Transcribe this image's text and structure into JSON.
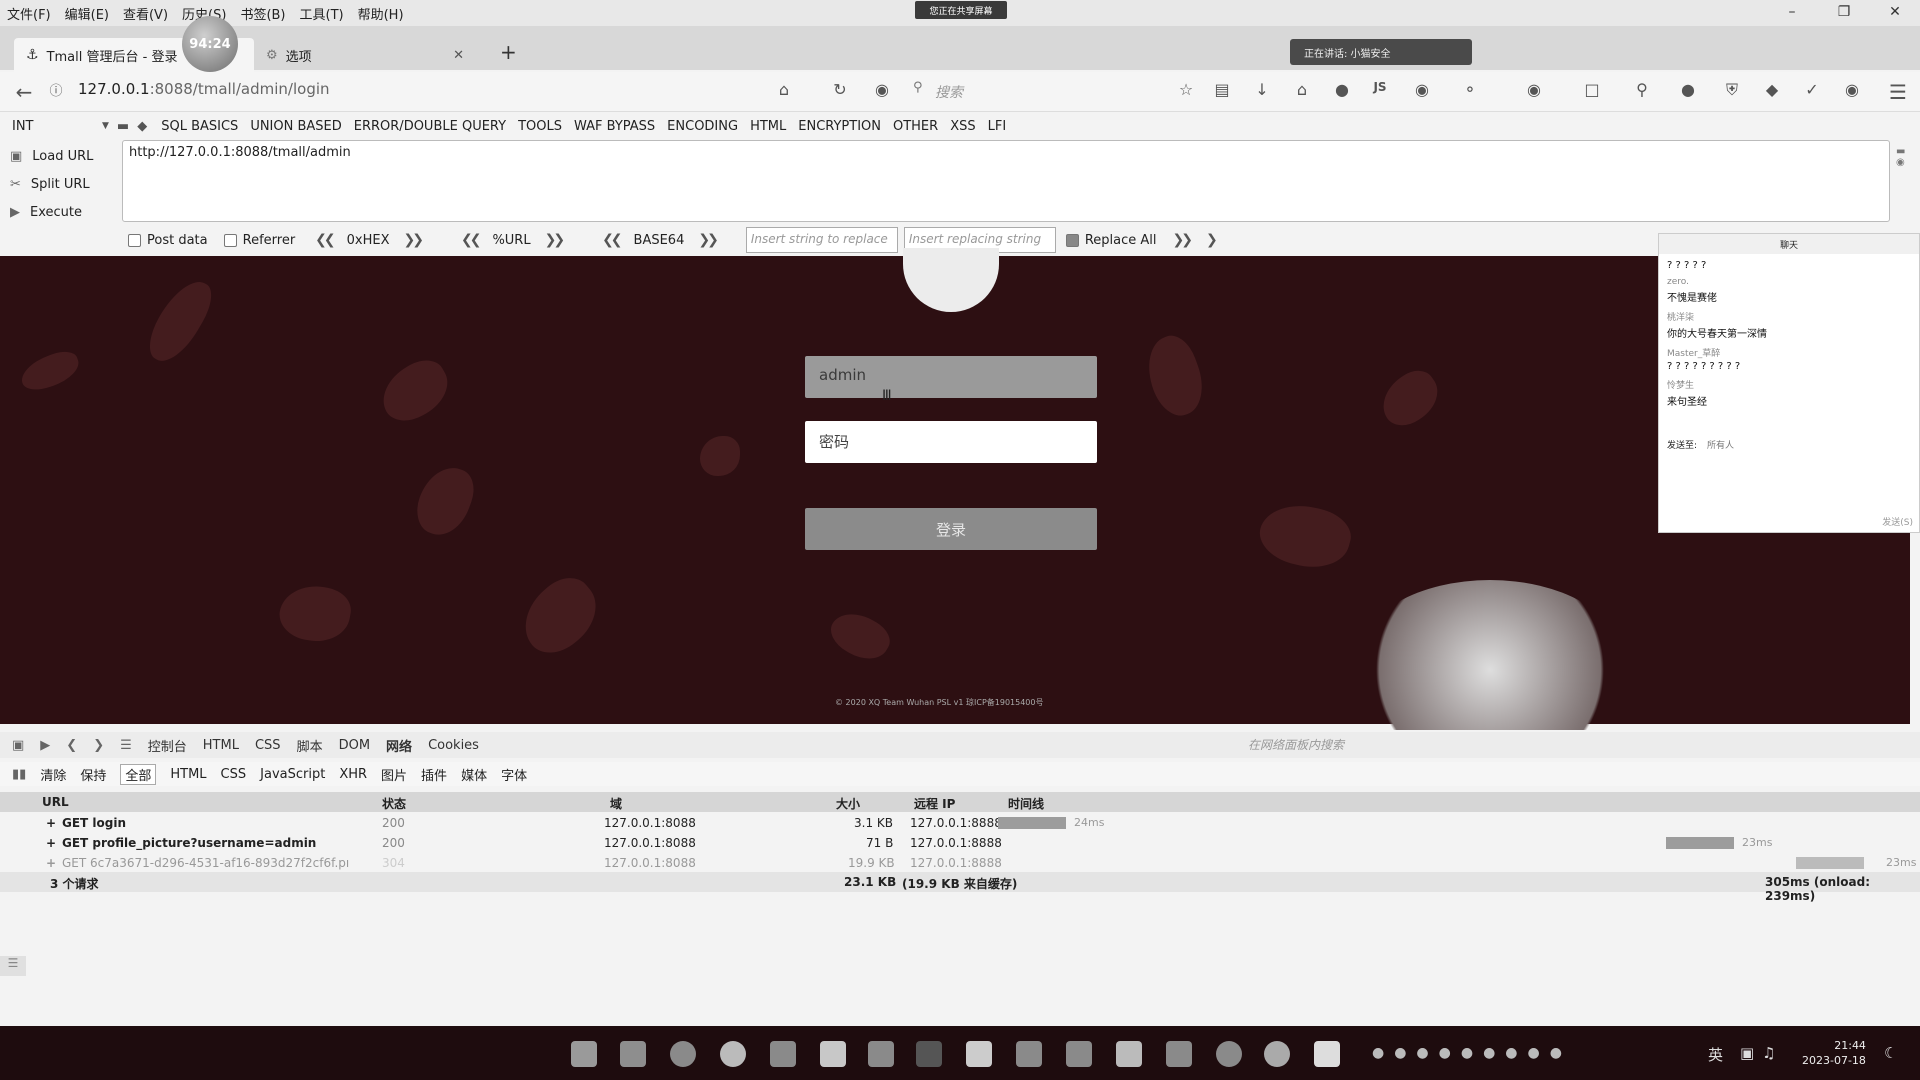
{
  "menubar": {
    "items": [
      "文件(F)",
      "编辑(E)",
      "查看(V)",
      "历史(S)",
      "书签(B)",
      "工具(T)",
      "帮助(H)"
    ],
    "share_banner": "您正在共享屏幕"
  },
  "recording_badge": "94:24",
  "tabs": {
    "active_title": "Tmall 管理后台 - 登录",
    "second_title": "选项",
    "new_tab": "+"
  },
  "speaking_indicator": "正在讲话: 小猫安全",
  "nav": {
    "url_host": "127.0.0.1",
    "url_rest": ":8088/tmall/admin/login",
    "search_placeholder": "搜索"
  },
  "hackbar": {
    "int_select": "INT",
    "menu": [
      "SQL BASICS",
      "UNION BASED",
      "ERROR/DOUBLE QUERY",
      "TOOLS",
      "WAF BYPASS",
      "ENCODING",
      "HTML",
      "ENCRYPTION",
      "OTHER",
      "XSS",
      "LFI"
    ],
    "load_url": "Load URL",
    "split_url": "Split URL",
    "execute": "Execute",
    "textarea_value": "http://127.0.0.1:8088/tmall/admin",
    "post_data": "Post data",
    "referrer": "Referrer",
    "hex": "0xHEX",
    "urlenc": "%URL",
    "base64": "BASE64",
    "insert_placeholder": "Insert string to replace",
    "replacing_placeholder": "Insert replacing string",
    "replace_all": "Replace All"
  },
  "login": {
    "username_value": "admin",
    "password_placeholder": "密码",
    "button": "登录",
    "footer": "© 2020 XQ Team Wuhan PSL v1   琼ICP备19015400号"
  },
  "chat": {
    "title": "聊天",
    "messages": [
      {
        "name": "",
        "text": "? ? ? ? ?"
      },
      {
        "name": "zero.",
        "text": "不愧是赛佬"
      },
      {
        "name": "桃洋柒",
        "text": "你的大号春天第一深情"
      },
      {
        "name": "Master_草醉",
        "text": "? ? ? ? ? ? ? ? ?"
      },
      {
        "name": "怜梦生",
        "text": "来句圣经"
      }
    ],
    "send_to_label": "发送至:",
    "send_to_value": "所有人",
    "send_button": "发送(S)"
  },
  "devtools": {
    "tabs": [
      "控制台",
      "HTML",
      "CSS",
      "脚本",
      "DOM",
      "网络",
      "Cookies"
    ],
    "active_tab": "网络",
    "search_placeholder": "在网络面板内搜索",
    "filters": [
      "清除",
      "保持",
      "全部",
      "HTML",
      "CSS",
      "JavaScript",
      "XHR",
      "图片",
      "插件",
      "媒体",
      "字体"
    ],
    "active_filter": "全部",
    "columns": [
      "URL",
      "状态",
      "域",
      "大小",
      "远程 IP",
      "时间线"
    ],
    "rows": [
      {
        "url": "GET login",
        "status": "200",
        "domain": "127.0.0.1:8088",
        "size": "3.1 KB",
        "ip": "127.0.0.1:8888",
        "time": "24ms",
        "cached": false
      },
      {
        "url": "GET profile_picture?username=admin",
        "status": "200",
        "domain": "127.0.0.1:8088",
        "size": "71 B",
        "ip": "127.0.0.1:8888",
        "time": "23ms",
        "cached": false
      },
      {
        "url": "GET 6c7a3671-d296-4531-af16-893d27f2cf6f.pı",
        "status": "304",
        "domain": "127.0.0.1:8088",
        "size": "19.9 KB",
        "ip": "127.0.0.1:8888",
        "time": "23ms",
        "cached": true
      }
    ],
    "summary": {
      "count": "3 个请求",
      "size": "23.1 KB",
      "cache": "(19.9 KB 来自缓存)",
      "total": "305ms (onload: 239ms)"
    }
  },
  "taskbar": {
    "ime": "英",
    "time": "21:44",
    "date": "2023-07-18"
  }
}
